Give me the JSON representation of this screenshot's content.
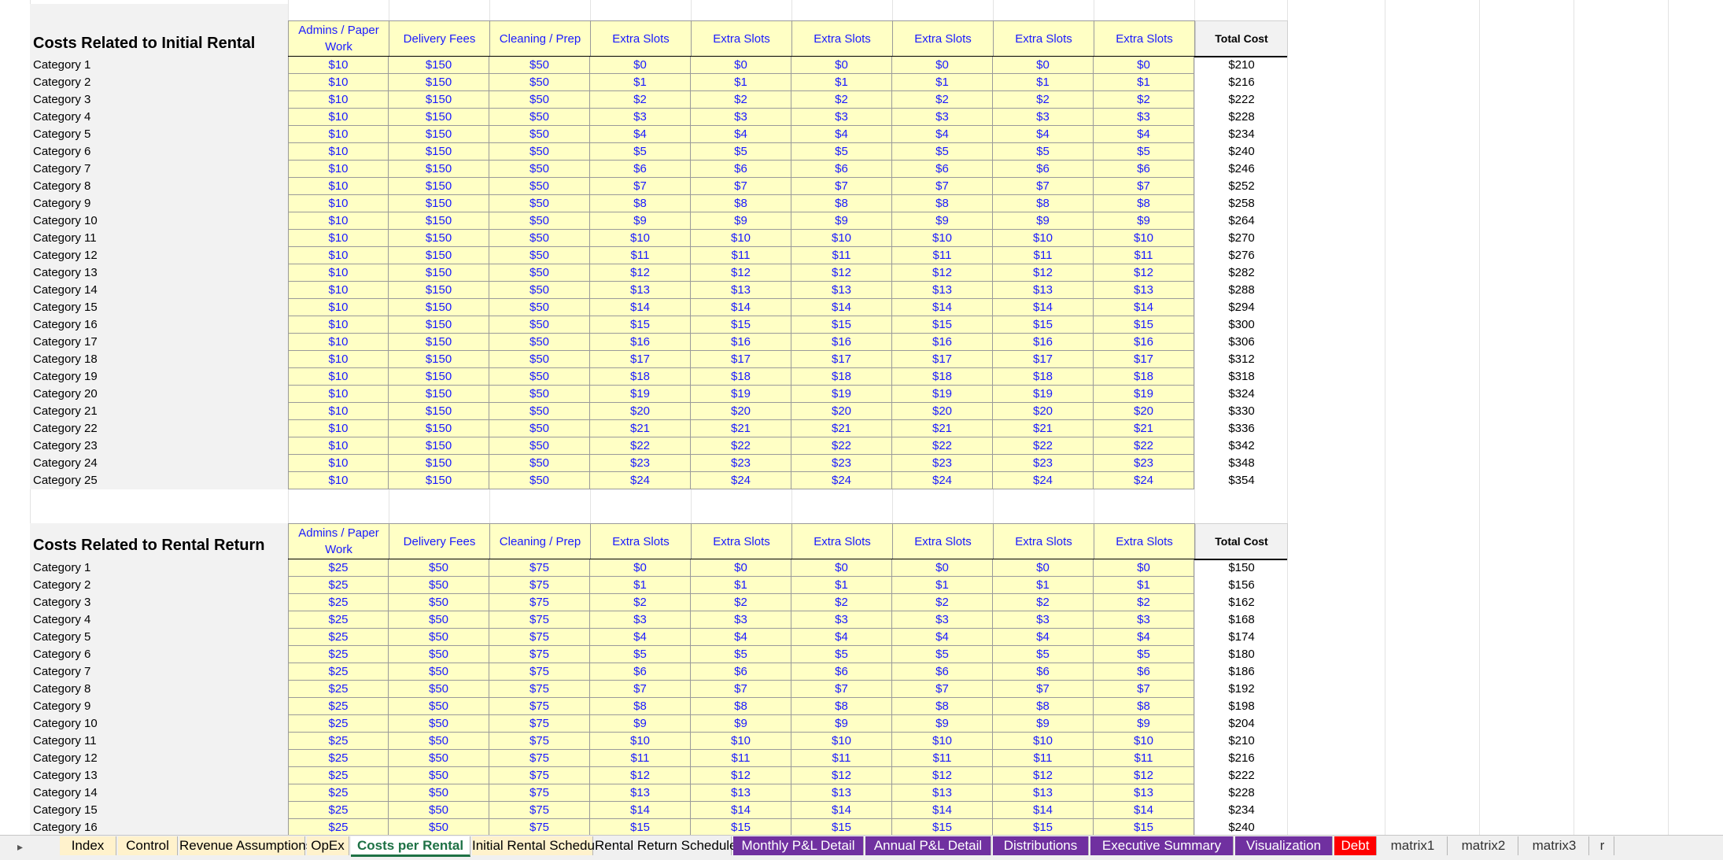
{
  "sections": [
    {
      "title": "Costs Related to Initial Rental",
      "headers": [
        "Admins / Paper Work",
        "Delivery Fees",
        "Cleaning / Prep",
        "Extra Slots",
        "Extra Slots",
        "Extra Slots",
        "Extra Slots",
        "Extra Slots",
        "Extra Slots"
      ],
      "total_header": "Total Cost",
      "rows": [
        {
          "label": "Category 1",
          "values": [
            "$10",
            "$150",
            "$50",
            "$0",
            "$0",
            "$0",
            "$0",
            "$0",
            "$0"
          ],
          "total": "$210"
        },
        {
          "label": "Category 2",
          "values": [
            "$10",
            "$150",
            "$50",
            "$1",
            "$1",
            "$1",
            "$1",
            "$1",
            "$1"
          ],
          "total": "$216"
        },
        {
          "label": "Category 3",
          "values": [
            "$10",
            "$150",
            "$50",
            "$2",
            "$2",
            "$2",
            "$2",
            "$2",
            "$2"
          ],
          "total": "$222"
        },
        {
          "label": "Category 4",
          "values": [
            "$10",
            "$150",
            "$50",
            "$3",
            "$3",
            "$3",
            "$3",
            "$3",
            "$3"
          ],
          "total": "$228"
        },
        {
          "label": "Category 5",
          "values": [
            "$10",
            "$150",
            "$50",
            "$4",
            "$4",
            "$4",
            "$4",
            "$4",
            "$4"
          ],
          "total": "$234"
        },
        {
          "label": "Category 6",
          "values": [
            "$10",
            "$150",
            "$50",
            "$5",
            "$5",
            "$5",
            "$5",
            "$5",
            "$5"
          ],
          "total": "$240"
        },
        {
          "label": "Category 7",
          "values": [
            "$10",
            "$150",
            "$50",
            "$6",
            "$6",
            "$6",
            "$6",
            "$6",
            "$6"
          ],
          "total": "$246"
        },
        {
          "label": "Category 8",
          "values": [
            "$10",
            "$150",
            "$50",
            "$7",
            "$7",
            "$7",
            "$7",
            "$7",
            "$7"
          ],
          "total": "$252"
        },
        {
          "label": "Category 9",
          "values": [
            "$10",
            "$150",
            "$50",
            "$8",
            "$8",
            "$8",
            "$8",
            "$8",
            "$8"
          ],
          "total": "$258"
        },
        {
          "label": "Category 10",
          "values": [
            "$10",
            "$150",
            "$50",
            "$9",
            "$9",
            "$9",
            "$9",
            "$9",
            "$9"
          ],
          "total": "$264"
        },
        {
          "label": "Category 11",
          "values": [
            "$10",
            "$150",
            "$50",
            "$10",
            "$10",
            "$10",
            "$10",
            "$10",
            "$10"
          ],
          "total": "$270"
        },
        {
          "label": "Category 12",
          "values": [
            "$10",
            "$150",
            "$50",
            "$11",
            "$11",
            "$11",
            "$11",
            "$11",
            "$11"
          ],
          "total": "$276"
        },
        {
          "label": "Category 13",
          "values": [
            "$10",
            "$150",
            "$50",
            "$12",
            "$12",
            "$12",
            "$12",
            "$12",
            "$12"
          ],
          "total": "$282"
        },
        {
          "label": "Category 14",
          "values": [
            "$10",
            "$150",
            "$50",
            "$13",
            "$13",
            "$13",
            "$13",
            "$13",
            "$13"
          ],
          "total": "$288"
        },
        {
          "label": "Category 15",
          "values": [
            "$10",
            "$150",
            "$50",
            "$14",
            "$14",
            "$14",
            "$14",
            "$14",
            "$14"
          ],
          "total": "$294"
        },
        {
          "label": "Category 16",
          "values": [
            "$10",
            "$150",
            "$50",
            "$15",
            "$15",
            "$15",
            "$15",
            "$15",
            "$15"
          ],
          "total": "$300"
        },
        {
          "label": "Category 17",
          "values": [
            "$10",
            "$150",
            "$50",
            "$16",
            "$16",
            "$16",
            "$16",
            "$16",
            "$16"
          ],
          "total": "$306"
        },
        {
          "label": "Category 18",
          "values": [
            "$10",
            "$150",
            "$50",
            "$17",
            "$17",
            "$17",
            "$17",
            "$17",
            "$17"
          ],
          "total": "$312"
        },
        {
          "label": "Category 19",
          "values": [
            "$10",
            "$150",
            "$50",
            "$18",
            "$18",
            "$18",
            "$18",
            "$18",
            "$18"
          ],
          "total": "$318"
        },
        {
          "label": "Category 20",
          "values": [
            "$10",
            "$150",
            "$50",
            "$19",
            "$19",
            "$19",
            "$19",
            "$19",
            "$19"
          ],
          "total": "$324"
        },
        {
          "label": "Category 21",
          "values": [
            "$10",
            "$150",
            "$50",
            "$20",
            "$20",
            "$20",
            "$20",
            "$20",
            "$20"
          ],
          "total": "$330"
        },
        {
          "label": "Category 22",
          "values": [
            "$10",
            "$150",
            "$50",
            "$21",
            "$21",
            "$21",
            "$21",
            "$21",
            "$21"
          ],
          "total": "$336"
        },
        {
          "label": "Category 23",
          "values": [
            "$10",
            "$150",
            "$50",
            "$22",
            "$22",
            "$22",
            "$22",
            "$22",
            "$22"
          ],
          "total": "$342"
        },
        {
          "label": "Category 24",
          "values": [
            "$10",
            "$150",
            "$50",
            "$23",
            "$23",
            "$23",
            "$23",
            "$23",
            "$23"
          ],
          "total": "$348"
        },
        {
          "label": "Category 25",
          "values": [
            "$10",
            "$150",
            "$50",
            "$24",
            "$24",
            "$24",
            "$24",
            "$24",
            "$24"
          ],
          "total": "$354"
        }
      ]
    },
    {
      "title": "Costs Related to Rental Return",
      "headers": [
        "Admins / Paper Work",
        "Delivery Fees",
        "Cleaning / Prep",
        "Extra Slots",
        "Extra Slots",
        "Extra Slots",
        "Extra Slots",
        "Extra Slots",
        "Extra Slots"
      ],
      "total_header": "Total Cost",
      "rows": [
        {
          "label": "Category 1",
          "values": [
            "$25",
            "$50",
            "$75",
            "$0",
            "$0",
            "$0",
            "$0",
            "$0",
            "$0"
          ],
          "total": "$150"
        },
        {
          "label": "Category 2",
          "values": [
            "$25",
            "$50",
            "$75",
            "$1",
            "$1",
            "$1",
            "$1",
            "$1",
            "$1"
          ],
          "total": "$156"
        },
        {
          "label": "Category 3",
          "values": [
            "$25",
            "$50",
            "$75",
            "$2",
            "$2",
            "$2",
            "$2",
            "$2",
            "$2"
          ],
          "total": "$162"
        },
        {
          "label": "Category 4",
          "values": [
            "$25",
            "$50",
            "$75",
            "$3",
            "$3",
            "$3",
            "$3",
            "$3",
            "$3"
          ],
          "total": "$168"
        },
        {
          "label": "Category 5",
          "values": [
            "$25",
            "$50",
            "$75",
            "$4",
            "$4",
            "$4",
            "$4",
            "$4",
            "$4"
          ],
          "total": "$174"
        },
        {
          "label": "Category 6",
          "values": [
            "$25",
            "$50",
            "$75",
            "$5",
            "$5",
            "$5",
            "$5",
            "$5",
            "$5"
          ],
          "total": "$180"
        },
        {
          "label": "Category 7",
          "values": [
            "$25",
            "$50",
            "$75",
            "$6",
            "$6",
            "$6",
            "$6",
            "$6",
            "$6"
          ],
          "total": "$186"
        },
        {
          "label": "Category 8",
          "values": [
            "$25",
            "$50",
            "$75",
            "$7",
            "$7",
            "$7",
            "$7",
            "$7",
            "$7"
          ],
          "total": "$192"
        },
        {
          "label": "Category 9",
          "values": [
            "$25",
            "$50",
            "$75",
            "$8",
            "$8",
            "$8",
            "$8",
            "$8",
            "$8"
          ],
          "total": "$198"
        },
        {
          "label": "Category 10",
          "values": [
            "$25",
            "$50",
            "$75",
            "$9",
            "$9",
            "$9",
            "$9",
            "$9",
            "$9"
          ],
          "total": "$204"
        },
        {
          "label": "Category 11",
          "values": [
            "$25",
            "$50",
            "$75",
            "$10",
            "$10",
            "$10",
            "$10",
            "$10",
            "$10"
          ],
          "total": "$210"
        },
        {
          "label": "Category 12",
          "values": [
            "$25",
            "$50",
            "$75",
            "$11",
            "$11",
            "$11",
            "$11",
            "$11",
            "$11"
          ],
          "total": "$216"
        },
        {
          "label": "Category 13",
          "values": [
            "$25",
            "$50",
            "$75",
            "$12",
            "$12",
            "$12",
            "$12",
            "$12",
            "$12"
          ],
          "total": "$222"
        },
        {
          "label": "Category 14",
          "values": [
            "$25",
            "$50",
            "$75",
            "$13",
            "$13",
            "$13",
            "$13",
            "$13",
            "$13"
          ],
          "total": "$228"
        },
        {
          "label": "Category 15",
          "values": [
            "$25",
            "$50",
            "$75",
            "$14",
            "$14",
            "$14",
            "$14",
            "$14",
            "$14"
          ],
          "total": "$234"
        },
        {
          "label": "Category 16",
          "values": [
            "$25",
            "$50",
            "$75",
            "$15",
            "$15",
            "$15",
            "$15",
            "$15",
            "$15"
          ],
          "total": "$240"
        }
      ]
    }
  ],
  "tabs": [
    {
      "label": "Index",
      "style": "tan"
    },
    {
      "label": "Control",
      "style": "tan"
    },
    {
      "label": "Revenue Assumptions",
      "style": "tan"
    },
    {
      "label": "OpEx",
      "style": "tan"
    },
    {
      "label": "Costs per Rental",
      "style": "active"
    },
    {
      "label": "Initial Rental Schedule",
      "style": "tan"
    },
    {
      "label": "Rental Return Schedule",
      "style": "plain"
    },
    {
      "label": "Monthly P&L Detail",
      "style": "purple"
    },
    {
      "label": "Annual P&L Detail",
      "style": "purple"
    },
    {
      "label": "Distributions",
      "style": "purple"
    },
    {
      "label": "Executive Summary",
      "style": "purple"
    },
    {
      "label": "Visualization",
      "style": "purple"
    },
    {
      "label": "Debt",
      "style": "red"
    },
    {
      "label": "matrix1",
      "style": "grey"
    },
    {
      "label": "matrix2",
      "style": "grey"
    },
    {
      "label": "matrix3",
      "style": "grey"
    },
    {
      "label": "r",
      "style": "grey"
    }
  ],
  "tab_nav_arrow": "▸",
  "colors": {
    "input_fill": "#ffffc5",
    "input_text": "#1a1aff",
    "purple_tab": "#7030a0",
    "red_tab": "#ff0000",
    "active_tab_text": "#1e7145"
  }
}
